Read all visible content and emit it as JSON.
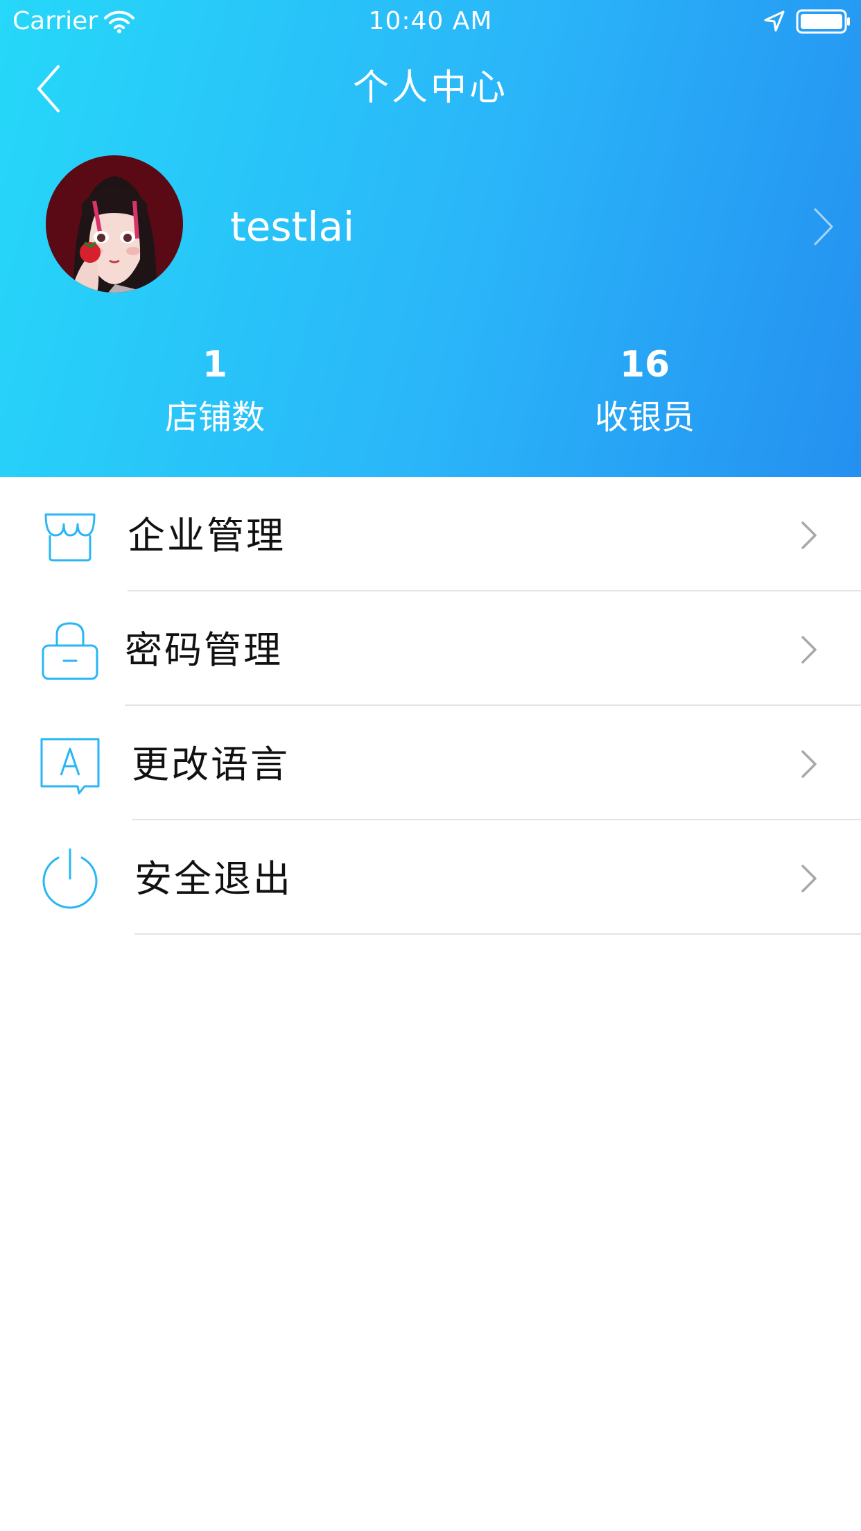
{
  "status_bar": {
    "carrier": "Carrier",
    "time": "10:40 AM"
  },
  "nav": {
    "title": "个人中心"
  },
  "profile": {
    "username": "testlai"
  },
  "stats": [
    {
      "value": "1",
      "label": "店铺数"
    },
    {
      "value": "16",
      "label": "收银员"
    }
  ],
  "menu": {
    "items": [
      {
        "label": "企业管理",
        "icon": "shop-icon"
      },
      {
        "label": "密码管理",
        "icon": "lock-icon"
      },
      {
        "label": "更改语言",
        "icon": "language-icon"
      },
      {
        "label": "安全退出",
        "icon": "power-icon"
      }
    ]
  },
  "colors": {
    "header_gradient_start": "#26d8f9",
    "header_gradient_end": "#2490f0",
    "icon_accent": "#29b6f6",
    "divider": "#e3e3e3",
    "chevron": "#a8a8a8"
  }
}
